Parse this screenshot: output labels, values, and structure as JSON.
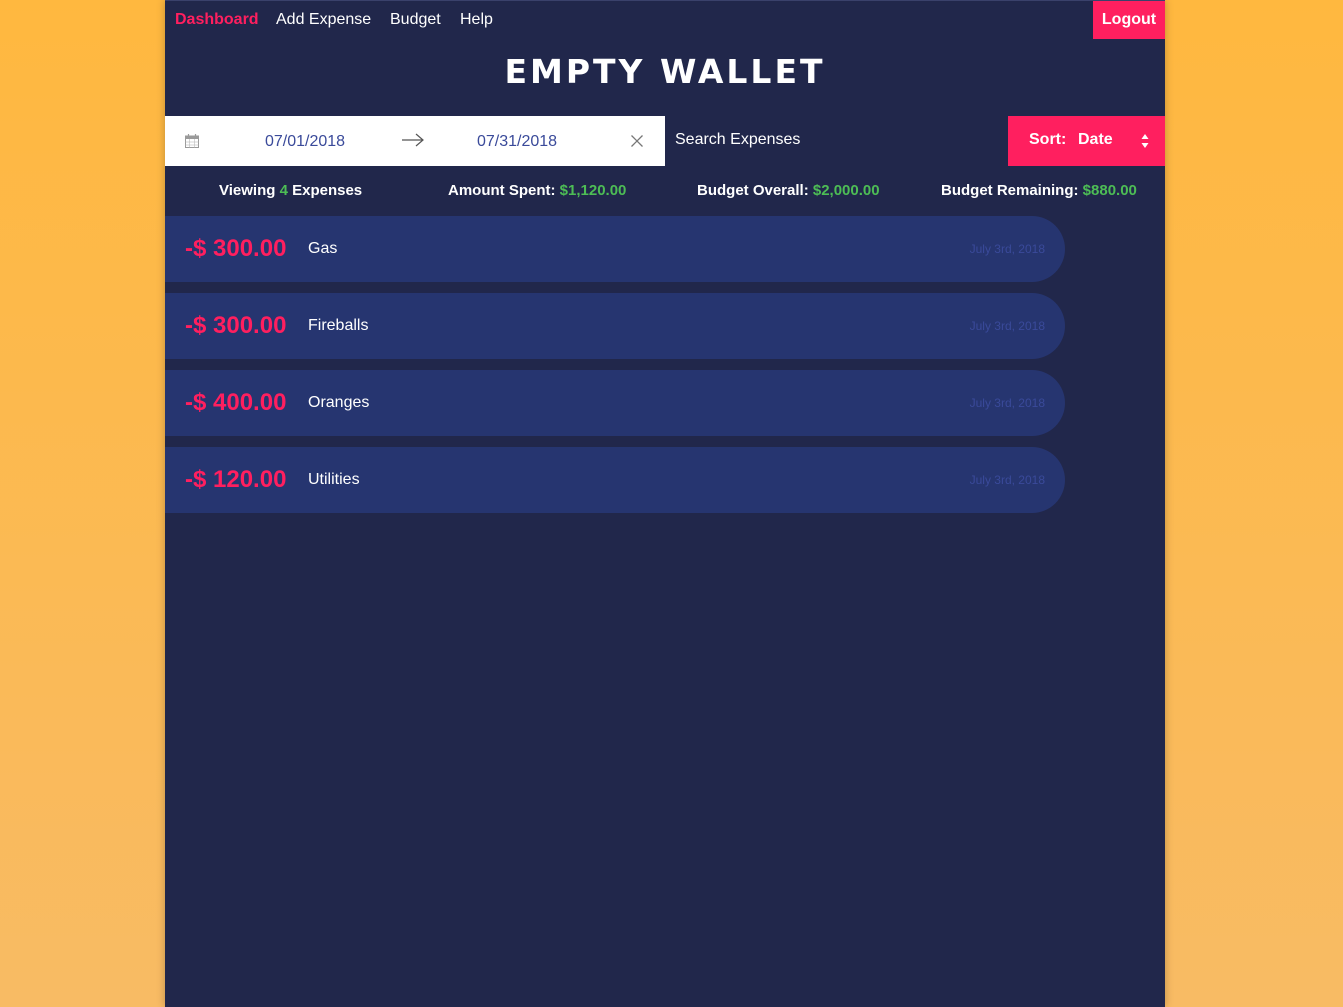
{
  "nav": {
    "items": [
      {
        "label": "Dashboard",
        "active": true
      },
      {
        "label": "Add Expense",
        "active": false
      },
      {
        "label": "Budget",
        "active": false
      },
      {
        "label": "Help",
        "active": false
      }
    ],
    "logout_label": "Logout"
  },
  "header": {
    "title": "EMPTY WALLET"
  },
  "filters": {
    "start_date": "07/01/2018",
    "end_date": "07/31/2018",
    "search_placeholder": "Search Expenses",
    "sort_label": "Sort:",
    "sort_value": "Date"
  },
  "summary": {
    "viewing_prefix": "Viewing",
    "viewing_count": "4",
    "viewing_suffix": "Expenses",
    "amount_spent_label": "Amount Spent:",
    "amount_spent_value": "$1,120.00",
    "budget_overall_label": "Budget Overall:",
    "budget_overall_value": "$2,000.00",
    "budget_remaining_label": "Budget Remaining:",
    "budget_remaining_value": "$880.00"
  },
  "expenses": [
    {
      "amount": "-$ 300.00",
      "description": "Gas",
      "date": "July 3rd, 2018"
    },
    {
      "amount": "-$ 300.00",
      "description": "Fireballs",
      "date": "July 3rd, 2018"
    },
    {
      "amount": "-$ 400.00",
      "description": "Oranges",
      "date": "July 3rd, 2018"
    },
    {
      "amount": "-$ 120.00",
      "description": "Utilities",
      "date": "July 3rd, 2018"
    }
  ],
  "colors": {
    "background": "#21274b",
    "accent": "#ff1f5f",
    "positive": "#4dbd55",
    "card": "#263570",
    "page_gradient": "#ffb83f"
  },
  "icons": {
    "calendar": "calendar-icon",
    "arrow": "arrow-right-icon",
    "clear": "close-icon",
    "sort": "sort-caret-icon"
  }
}
